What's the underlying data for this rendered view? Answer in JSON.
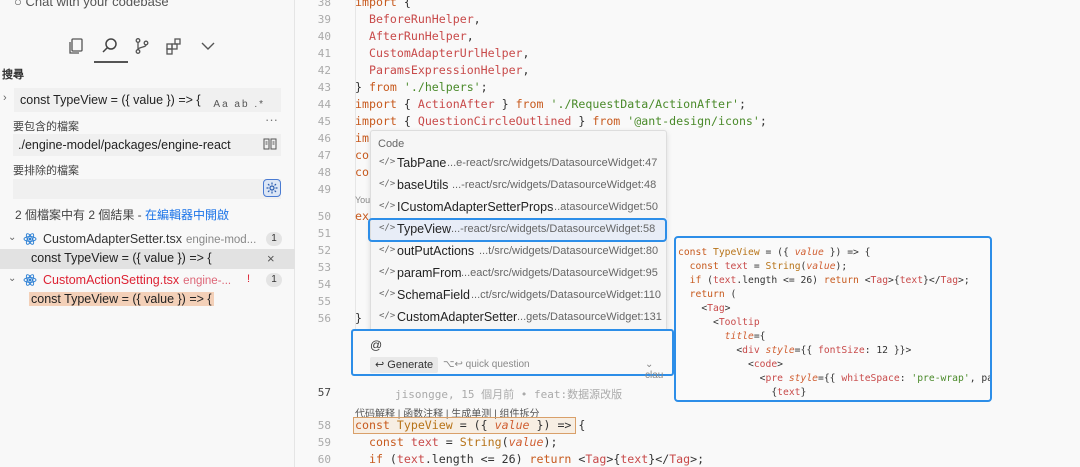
{
  "sidebar": {
    "chat_title": "Chat with your codebase",
    "section_label": "搜尋",
    "search_value": "const TypeView = ({ value }) => {",
    "search_options": "Aa ab .*",
    "include_label": "要包含的檔案",
    "more": "···",
    "include_value": "./engine-model/packages/engine-react",
    "exclude_label": "要排除的檔案",
    "summary_text": "2 個檔案中有 2 個結果 - ",
    "summary_link": "在編輯器中開啟",
    "files": [
      {
        "name": "CustomAdapterSetter.tsx",
        "path": "engine-mod...",
        "count": "1"
      },
      {
        "name": "CustomActionSetting.tsx",
        "path": "engine-...",
        "count": "1",
        "warn": "!"
      }
    ],
    "matches": [
      "const TypeView = ({ value }) => {",
      "const TypeView = ({ value }) => {"
    ],
    "close": "×",
    "chevron_right": "›",
    "chevron_down": "⌄"
  },
  "editor": {
    "you_text": "You",
    "blame": "jisongge, 15 個月前 • feat:数据源改版",
    "line57": "57",
    "commands": "代码解释 | 函数注释 | 生成单测 | 组件拆分"
  },
  "popup": {
    "header": "Code",
    "icon": "</>",
    "items": [
      {
        "name": "TabPane",
        "path": "...e-react/src/widgets/DatasourceWidget:47"
      },
      {
        "name": "baseUtils",
        "path": "...-react/src/widgets/DatasourceWidget:48"
      },
      {
        "name": "ICustomAdapterSetterProps",
        "path": "...atasourceWidget:50"
      },
      {
        "name": "TypeView",
        "path": "...-react/src/widgets/DatasourceWidget:58"
      },
      {
        "name": "outPutActions",
        "path": "...t/src/widgets/DatasourceWidget:80"
      },
      {
        "name": "paramFrom",
        "path": "...eact/src/widgets/DatasourceWidget:95"
      },
      {
        "name": "SchemaField",
        "path": "...ct/src/widgets/DatasourceWidget:110"
      },
      {
        "name": "CustomAdapterSetter",
        "path": "...gets/DatasourceWidget:131"
      }
    ]
  },
  "chatbox": {
    "input": "@",
    "generate_label": "↩ Generate",
    "quick_question": "⌥↩ quick question",
    "model": "⌄ clau"
  }
}
